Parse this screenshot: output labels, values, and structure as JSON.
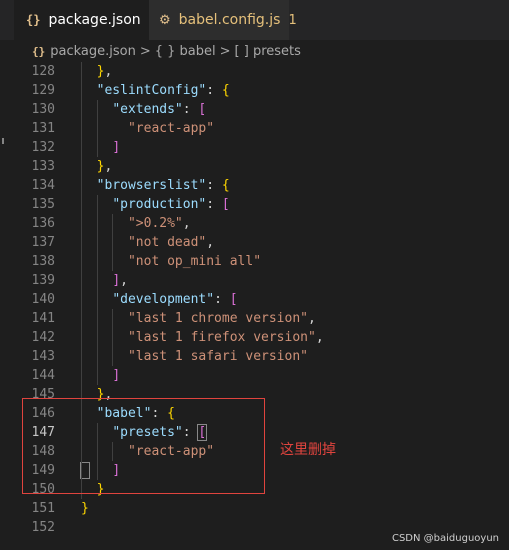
{
  "tabs": [
    {
      "icon": "{}",
      "label": "package.json",
      "close": "✕"
    },
    {
      "icon": "⚙",
      "label": "babel.config.js",
      "badge": "1"
    }
  ],
  "breadcrumb": {
    "icon": "{}",
    "items": [
      "package.json",
      "{ } babel",
      "[ ] presets"
    ],
    "separator": ">"
  },
  "code_lines": [
    {
      "n": "128",
      "t": "    },"
    },
    {
      "n": "129",
      "t": "    \"eslintConfig\": {"
    },
    {
      "n": "130",
      "t": "      \"extends\": ["
    },
    {
      "n": "131",
      "t": "        \"react-app\""
    },
    {
      "n": "132",
      "t": "      ]"
    },
    {
      "n": "133",
      "t": "    },"
    },
    {
      "n": "134",
      "t": "    \"browserslist\": {"
    },
    {
      "n": "135",
      "t": "      \"production\": ["
    },
    {
      "n": "136",
      "t": "        \">0.2%\","
    },
    {
      "n": "137",
      "t": "        \"not dead\","
    },
    {
      "n": "138",
      "t": "        \"not op_mini all\""
    },
    {
      "n": "139",
      "t": "      ],"
    },
    {
      "n": "140",
      "t": "      \"development\": ["
    },
    {
      "n": "141",
      "t": "        \"last 1 chrome version\","
    },
    {
      "n": "142",
      "t": "        \"last 1 firefox version\","
    },
    {
      "n": "143",
      "t": "        \"last 1 safari version\""
    },
    {
      "n": "144",
      "t": "      ]"
    },
    {
      "n": "145",
      "t": "    },"
    },
    {
      "n": "146",
      "t": "    \"babel\": {"
    },
    {
      "n": "147",
      "t": "      \"presets\": ["
    },
    {
      "n": "148",
      "t": "        \"react-app\""
    },
    {
      "n": "149",
      "t": "      ]"
    },
    {
      "n": "150",
      "t": "    }"
    },
    {
      "n": "151",
      "t": "  }"
    },
    {
      "n": "152",
      "t": ""
    }
  ],
  "current_line": "147",
  "annotation": "这里删掉",
  "watermark": "CSDN @baiduguoyun",
  "colors": {
    "background": "#1e1e1e",
    "key": "#9cdcfe",
    "string": "#ce9178",
    "annotation": "#e0443e"
  }
}
